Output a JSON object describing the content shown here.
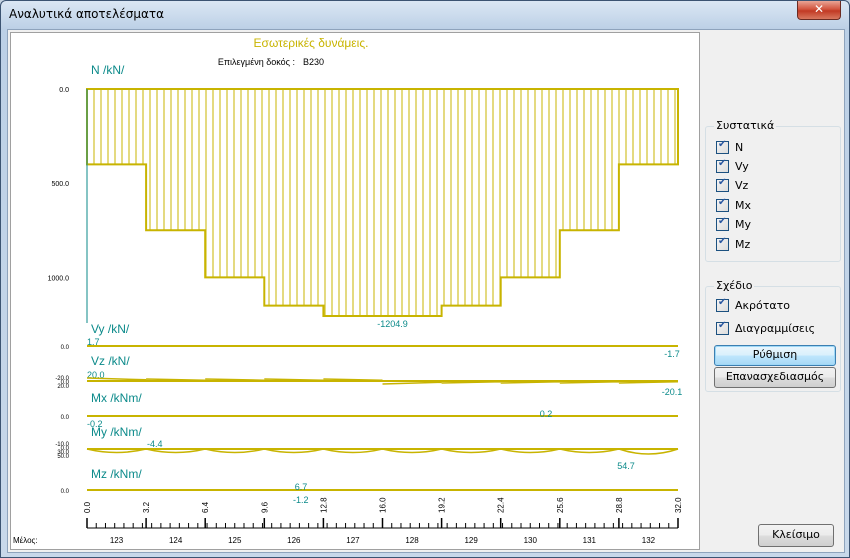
{
  "window": {
    "title": "Αναλυτικά αποτελέσματα",
    "close_glyph": "✕"
  },
  "colors": {
    "diagram": "#c8b400",
    "label": "#0b8a8a",
    "axis": "#000000"
  },
  "plot": {
    "heading": "Εσωτερικές δυνάμεις.",
    "beam_label": "Επιλεγμένη δοκός :",
    "beam_id": "B230",
    "panels": [
      {
        "label": "N /kN/",
        "ticks": [
          "0.0",
          "500.0",
          "1000.0"
        ],
        "max_text": "-1204.9"
      },
      {
        "label": "Vy /kN/",
        "min_text": "1.7",
        "max_text": "-1.7",
        "ticks": [
          "0.0"
        ]
      },
      {
        "label": "Vz /kN/",
        "min_text": "20.0",
        "max_text": "-20.1",
        "ticks": [
          "-20.0",
          "0.0",
          "20.0"
        ]
      },
      {
        "label": "Mx /kNm/",
        "min_text": "-0.2",
        "max_text": "0.2",
        "ticks": [
          "0.0"
        ]
      },
      {
        "label": "My /kNm/",
        "min_text": "-4.4",
        "max_text": "54.7",
        "ticks": [
          "-10.0",
          "0.0",
          "30.0",
          "50.0"
        ]
      },
      {
        "label": "Mz /kNm/",
        "min_text": "-1.2",
        "max_text": "6.7",
        "ticks": [
          "0.0"
        ]
      }
    ],
    "x_ticks": [
      "0.0",
      "3.2",
      "6.4",
      "9.6",
      "12.8",
      "16.0",
      "19.2",
      "22.4",
      "25.6",
      "28.8",
      "32.0"
    ],
    "members_label": "Μέλος:",
    "members": [
      "123",
      "124",
      "125",
      "126",
      "127",
      "128",
      "129",
      "130",
      "131",
      "132"
    ]
  },
  "chart_data": {
    "type": "area",
    "title": "Εσωτερικές δυνάμεις.",
    "ylabel": "N /kN/",
    "x": [
      0.0,
      3.2,
      6.4,
      9.6,
      12.8,
      16.0,
      19.2,
      22.4,
      25.6,
      28.8,
      32.0
    ],
    "series": [
      {
        "name": "N /kN/",
        "values": [
          -400,
          -750,
          -1000,
          -1150,
          -1204.9,
          -1204.9,
          -1150,
          -1000,
          -750,
          -400,
          -400
        ]
      }
    ],
    "ylim": [
      0,
      1250
    ]
  },
  "components": {
    "legend": "Συστατικά",
    "items": [
      "N",
      "Vy",
      "Vz",
      "Mx",
      "My",
      "Mz"
    ]
  },
  "drawing": {
    "legend": "Σχέδιο",
    "items": [
      "Ακρότατο",
      "Διαγραμμίσεις"
    ],
    "settings_button": "Ρύθμιση",
    "redraw_button": "Επανασχεδιασμός"
  },
  "close_button": "Κλείσιμο"
}
